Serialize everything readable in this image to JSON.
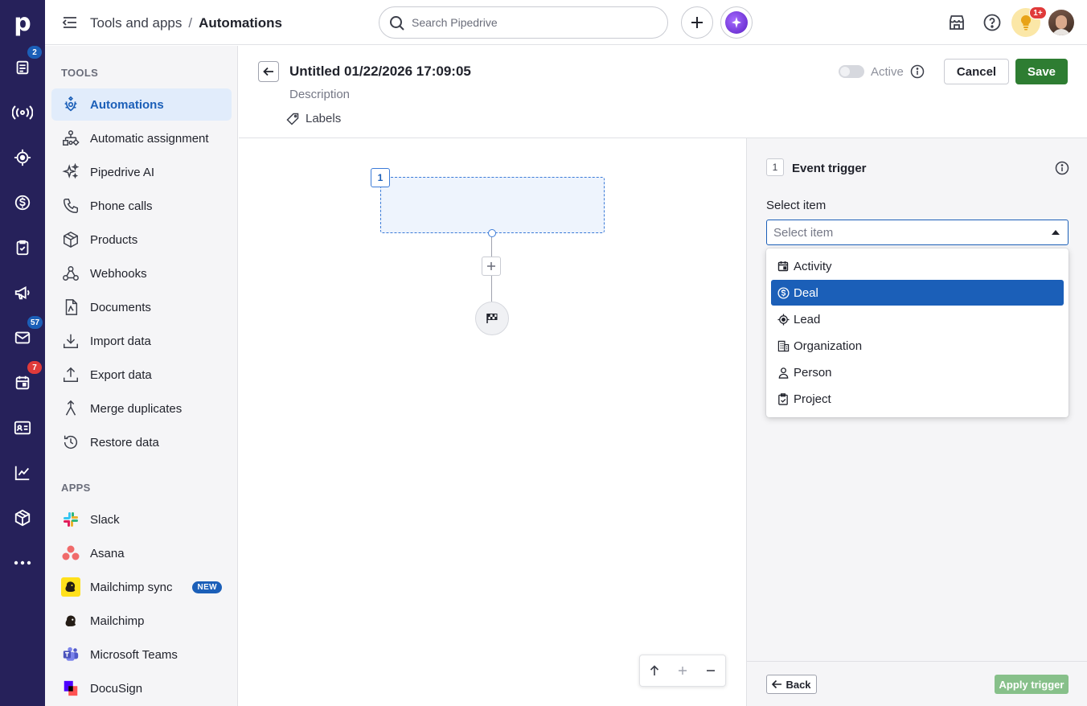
{
  "rail": {
    "logo": "p",
    "badges": {
      "leads": "2",
      "mail": "57",
      "calendar": "7"
    },
    "colors": {
      "bg": "#26215a",
      "badge_blue": "#1b5fb8",
      "badge_red": "#e03a3a"
    }
  },
  "topbar": {
    "breadcrumb_parent": "Tools and apps",
    "breadcrumb_sep": "/",
    "breadcrumb_current": "Automations",
    "search_placeholder": "Search Pipedrive",
    "notif_badge": "1+"
  },
  "sidebar": {
    "tools_heading": "TOOLS",
    "tools": [
      {
        "label": "Automations",
        "icon": "automations-icon",
        "active": true
      },
      {
        "label": "Automatic assignment",
        "icon": "assignment-icon"
      },
      {
        "label": "Pipedrive AI",
        "icon": "sparkle-icon"
      },
      {
        "label": "Phone calls",
        "icon": "phone-icon"
      },
      {
        "label": "Products",
        "icon": "box-icon"
      },
      {
        "label": "Webhooks",
        "icon": "webhook-icon"
      },
      {
        "label": "Documents",
        "icon": "document-icon"
      },
      {
        "label": "Import data",
        "icon": "download-icon"
      },
      {
        "label": "Export data",
        "icon": "upload-icon"
      },
      {
        "label": "Merge duplicates",
        "icon": "merge-icon"
      },
      {
        "label": "Restore data",
        "icon": "restore-icon"
      }
    ],
    "apps_heading": "APPS",
    "apps": [
      {
        "label": "Slack",
        "icon": "slack-icon"
      },
      {
        "label": "Asana",
        "icon": "asana-icon"
      },
      {
        "label": "Mailchimp sync",
        "icon": "mailchimp-icon",
        "badge": "NEW"
      },
      {
        "label": "Mailchimp",
        "icon": "mailchimp-mono-icon"
      },
      {
        "label": "Microsoft Teams",
        "icon": "teams-icon"
      },
      {
        "label": "DocuSign",
        "icon": "docusign-icon"
      }
    ]
  },
  "editor": {
    "title": "Untitled 01/22/2026 17:09:05",
    "description_placeholder": "Description",
    "labels_label": "Labels",
    "active_label": "Active",
    "cancel_label": "Cancel",
    "save_label": "Save",
    "save_color": "#2e7d32"
  },
  "canvas": {
    "step_number": "1"
  },
  "panel": {
    "step_number": "1",
    "title": "Event trigger",
    "select_label": "Select item",
    "select_placeholder": "Select item",
    "options": [
      {
        "label": "Activity",
        "icon": "calendar-icon"
      },
      {
        "label": "Deal",
        "icon": "dollar-icon",
        "selected": true
      },
      {
        "label": "Lead",
        "icon": "target-icon"
      },
      {
        "label": "Organization",
        "icon": "building-icon"
      },
      {
        "label": "Person",
        "icon": "person-icon"
      },
      {
        "label": "Project",
        "icon": "clipboard-icon"
      }
    ],
    "back_label": "Back",
    "apply_label": "Apply trigger",
    "apply_color": "#87c08a"
  }
}
